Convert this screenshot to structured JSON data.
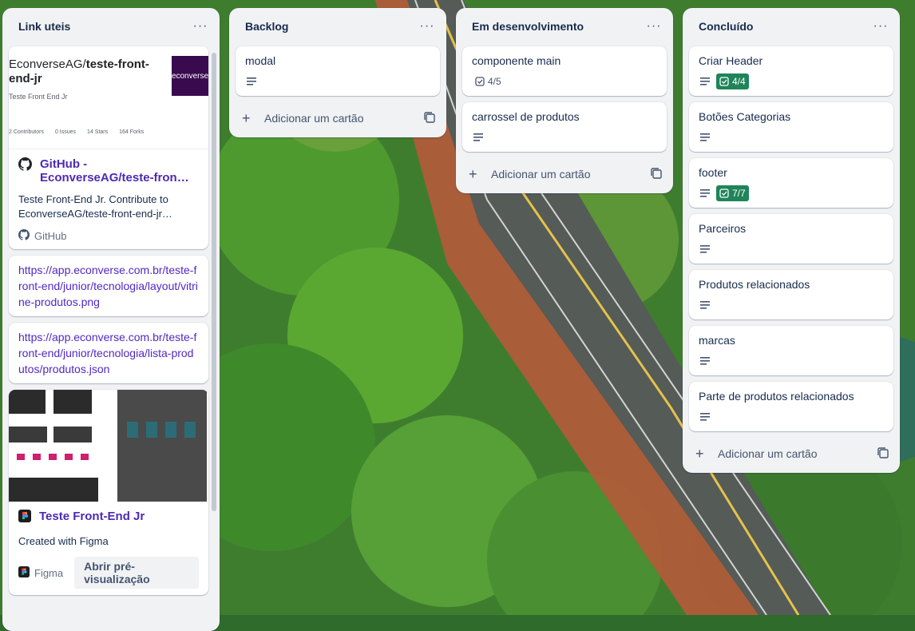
{
  "lists": {
    "links": {
      "title": "Link uteis",
      "menu_icon": "more-horizontal-icon",
      "github_card": {
        "thumb_title_prefix": "EconverseAG/",
        "thumb_title_repo": "teste-front-end-jr",
        "thumb_subtitle": "Teste Front End Jr",
        "thumb_logo_text": "econverse",
        "thumb_stats": [
          "2 Contributors",
          "0 Issues",
          "14 Stars",
          "164 Forks"
        ],
        "title": "GitHub - EconverseAG/teste-fron…",
        "description": "Teste Front-End Jr. Contribute to EconverseAG/teste-front-end-jr…",
        "source": "GitHub"
      },
      "url_card_1": "https://app.econverse.com.br/teste-front-end/junior/tecnologia/layout/vitrine-produtos.png",
      "url_card_2": "https://app.econverse.com.br/teste-front-end/junior/tecnologia/lista-produtos/produtos.json",
      "figma_card": {
        "title": "Teste Front-End Jr",
        "description": "Created with Figma",
        "source": "Figma",
        "preview_button": "Abrir pré-visualização"
      }
    },
    "backlog": {
      "title": "Backlog",
      "cards": [
        {
          "title": "modal"
        }
      ],
      "add_card": "Adicionar um cartão"
    },
    "dev": {
      "title": "Em desenvolvimento",
      "cards": [
        {
          "title": "componente main",
          "checklist": "4/5"
        },
        {
          "title": "carrossel de produtos"
        }
      ],
      "add_card": "Adicionar um cartão"
    },
    "done": {
      "title": "Concluído",
      "cards": [
        {
          "title": "Criar Header",
          "checklist": "4/4"
        },
        {
          "title": "Botões Categorias"
        },
        {
          "title": "footer",
          "checklist": "7/7"
        },
        {
          "title": "Parceiros"
        },
        {
          "title": "Produtos relacionados"
        },
        {
          "title": "marcas"
        },
        {
          "title": "Parte de produtos relacionados"
        }
      ],
      "add_card": "Adicionar um cartão"
    }
  },
  "colors": {
    "list_bg": "#f1f2f4",
    "checklist_complete": "#1f845a",
    "link_title": "#4c2ab5"
  }
}
